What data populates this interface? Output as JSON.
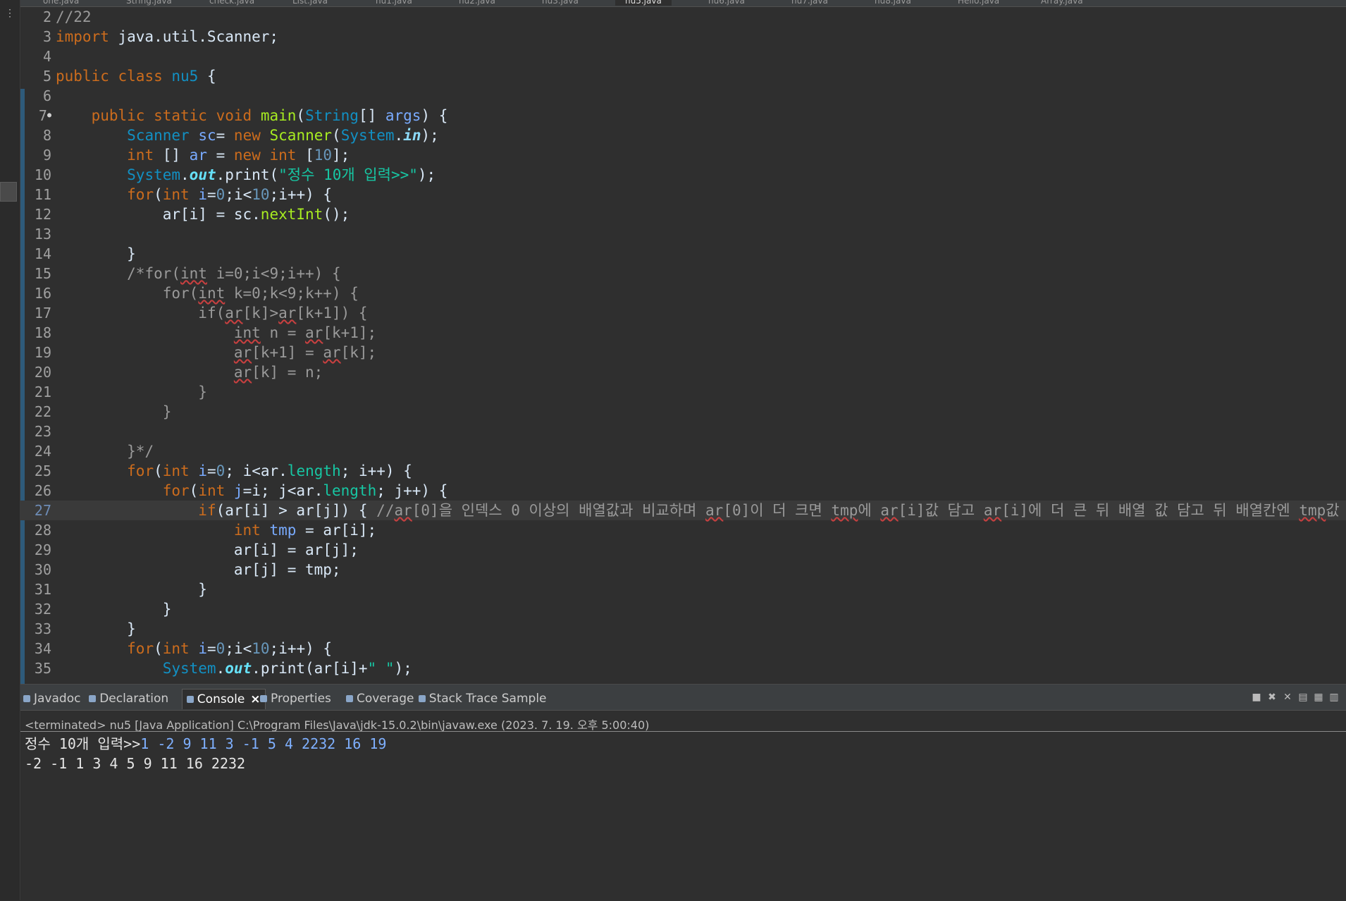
{
  "editor_tabs": [
    "one.java",
    "String.java",
    "check.java",
    "List.java",
    "nu1.java",
    "nu2.java",
    "nu3.java",
    "nu5.java",
    "nu6.java",
    "nu7.java",
    "nu8.java",
    "Hello.java",
    "Array.java"
  ],
  "active_tab_index": 7,
  "lines": [
    {
      "n": "2",
      "html": "<span class=\"c\">//22</span>"
    },
    {
      "n": "3",
      "html": "<span class=\"k\">import</span> java.util.Scanner;"
    },
    {
      "n": "4",
      "html": ""
    },
    {
      "n": "5",
      "html": "<span class=\"k\">public</span> <span class=\"k\">class</span> <span class=\"t\">nu5</span> {"
    },
    {
      "n": "6",
      "html": ""
    },
    {
      "n": "7",
      "dot": true,
      "html": "    <span class=\"k\">public</span> <span class=\"k\">static</span> <span class=\"k\">void</span> <span class=\"f\">main</span>(<span class=\"t\">String</span>[] <span class=\"v\">args</span>) {"
    },
    {
      "n": "8",
      "html": "        <span class=\"t\">Scanner</span> <span class=\"v\">sc</span>= <span class=\"k\">new</span> <span class=\"f\">Scanner</span>(<span class=\"t\">System</span>.<span class=\"it\">in</span>);"
    },
    {
      "n": "9",
      "html": "        <span class=\"k\">int</span> [] <span class=\"v\">ar</span> = <span class=\"k\">new</span> <span class=\"k\">int</span> [<span class=\"n\">10</span>];"
    },
    {
      "n": "10",
      "html": "        <span class=\"t\">System</span>.<span class=\"fld\">out</span>.print(<span class=\"s\">\"정수 10개 입력>>\"</span>);"
    },
    {
      "n": "11",
      "html": "        <span class=\"k\">for</span>(<span class=\"k\">int</span> <span class=\"v\">i</span>=<span class=\"n\">0</span>;i&lt;<span class=\"n\">10</span>;i++) {"
    },
    {
      "n": "12",
      "html": "            ar[i] = sc.<span class=\"f\">nextInt</span>();"
    },
    {
      "n": "13",
      "html": ""
    },
    {
      "n": "14",
      "html": "        }"
    },
    {
      "n": "15",
      "html": "        <span class=\"c\">/*for(<span class=\"u\">int</span> i=0;i&lt;9;i++) {</span>"
    },
    {
      "n": "16",
      "html": "            <span class=\"c\">for(<span class=\"u\">int</span> k=0;k&lt;9;k++) {</span>"
    },
    {
      "n": "17",
      "html": "                <span class=\"c\">if(<span class=\"u\">ar</span>[k]&gt;<span class=\"u\">ar</span>[k+1]) {</span>"
    },
    {
      "n": "18",
      "html": "                    <span class=\"c\"><span class=\"u\">int</span> n = <span class=\"u\">ar</span>[k+1];</span>"
    },
    {
      "n": "19",
      "html": "                    <span class=\"c\"><span class=\"u\">ar</span>[k+1] = <span class=\"u\">ar</span>[k];</span>"
    },
    {
      "n": "20",
      "html": "                    <span class=\"c\"><span class=\"u\">ar</span>[k] = n;</span>"
    },
    {
      "n": "21",
      "html": "                <span class=\"c\">}</span>"
    },
    {
      "n": "22",
      "html": "            <span class=\"c\">}</span>"
    },
    {
      "n": "23",
      "html": ""
    },
    {
      "n": "24",
      "html": "        <span class=\"c\">}*/</span>"
    },
    {
      "n": "25",
      "html": "        <span class=\"k\">for</span>(<span class=\"k\">int</span> <span class=\"v\">i</span>=<span class=\"n\">0</span>; i&lt;ar.<span class=\"s\">length</span>; i++) {"
    },
    {
      "n": "26",
      "html": "            <span class=\"k\">for</span>(<span class=\"k\">int</span> <span class=\"v\">j</span>=i; j&lt;ar.<span class=\"s\">length</span>; j++) {"
    },
    {
      "n": "27",
      "current": true,
      "html": "                <span class=\"k\">if</span>(ar[i] &gt; ar[j]) { <span class=\"c\">//<span class=\"u\">ar</span>[0]을 인덱스 0 이상의 배열값과 비교하며 <span class=\"u\">ar</span>[0]이 더 크면 <span class=\"u\">tmp</span>에 <span class=\"u\">ar</span>[i]값 담고 <span class=\"u\">ar</span>[i]에 더 큰 뒤 배열 값 담고 뒤 배열칸엔 <span class=\"u\">tmp</span>값 담음</span><span class=\"caret\"></span>"
    },
    {
      "n": "28",
      "html": "                    <span class=\"k\">int</span> <span class=\"v\">tmp</span> = ar[i];"
    },
    {
      "n": "29",
      "html": "                    ar[i] = ar[j];"
    },
    {
      "n": "30",
      "html": "                    ar[j] = tmp;"
    },
    {
      "n": "31",
      "html": "                }"
    },
    {
      "n": "32",
      "html": "            }"
    },
    {
      "n": "33",
      "html": "        }"
    },
    {
      "n": "34",
      "html": "        <span class=\"k\">for</span>(<span class=\"k\">int</span> <span class=\"v\">i</span>=<span class=\"n\">0</span>;i&lt;<span class=\"n\">10</span>;i++) {"
    },
    {
      "n": "35",
      "html": "            <span class=\"t\">System</span>.<span class=\"fld\">out</span>.print(ar[i]+<span class=\"s\">\" \"</span>);"
    }
  ],
  "console": {
    "tabs": [
      {
        "label": "Javadoc",
        "icon": "javadoc-icon"
      },
      {
        "label": "Declaration",
        "icon": "declaration-icon"
      },
      {
        "label": "Console",
        "icon": "console-icon",
        "active": true
      },
      {
        "label": "Properties",
        "icon": "properties-icon"
      },
      {
        "label": "Coverage",
        "icon": "coverage-icon"
      },
      {
        "label": "Stack Trace Sample",
        "icon": "stack-trace-icon"
      }
    ],
    "status": "<terminated> nu5 [Java Application] C:\\Program Files\\Java\\jdk-15.0.2\\bin\\javaw.exe  (2023. 7. 19. 오후 5:00:40)",
    "prompt": "정수 10개 입력>>",
    "input": "1 -2 9 11 3 -1 5 4 2232 16 19",
    "output": "-2 -1 1 3 4 5 9 11 16 2232"
  }
}
